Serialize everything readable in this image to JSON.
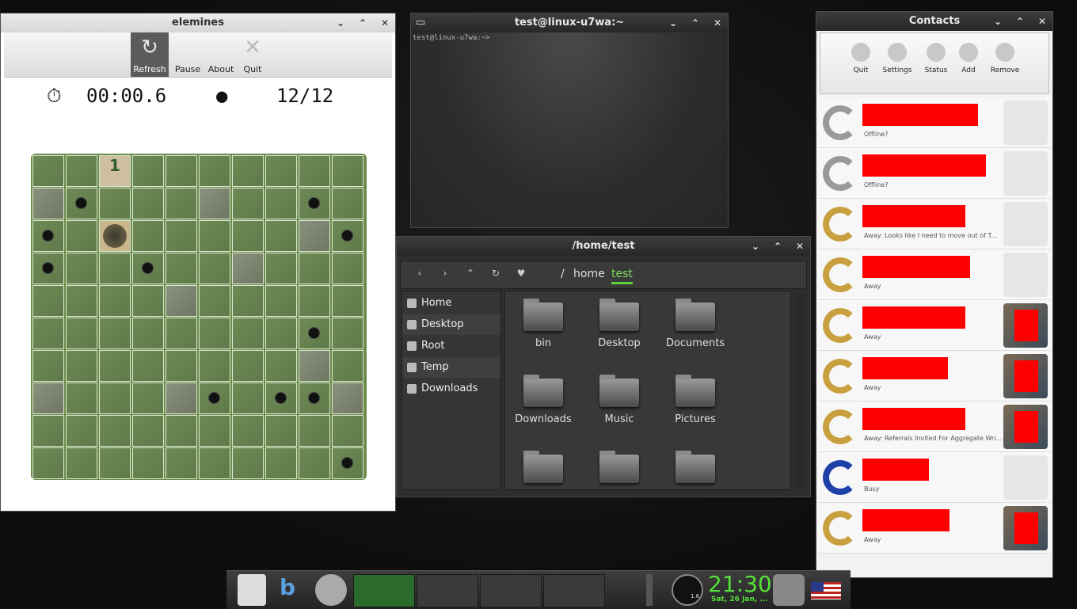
{
  "elemines": {
    "title": "elemines",
    "toolbar": {
      "refresh": "Refresh",
      "pause": "Pause",
      "about": "About",
      "quit": "Quit"
    },
    "timer": "00:00.6",
    "mines_counter": "12/12",
    "revealed_number": "1"
  },
  "terminal": {
    "title": "test@linux-u7wa:~",
    "prompt": "test@linux-u7wa:~> "
  },
  "filemanager": {
    "title": "/home/test",
    "breadcrumb": {
      "root": "/",
      "home": "home",
      "current": "test"
    },
    "sidebar": [
      {
        "label": "Home"
      },
      {
        "label": "Desktop"
      },
      {
        "label": "Root"
      },
      {
        "label": "Temp"
      },
      {
        "label": "Downloads"
      }
    ],
    "folders": [
      {
        "label": "bin"
      },
      {
        "label": "Desktop"
      },
      {
        "label": "Documents"
      },
      {
        "label": "Downloads"
      },
      {
        "label": "Music"
      },
      {
        "label": "Pictures"
      },
      {
        "label": ""
      },
      {
        "label": ""
      },
      {
        "label": ""
      }
    ]
  },
  "contacts": {
    "title": "Contacts",
    "toolbar": {
      "quit": "Quit",
      "settings": "Settings",
      "status": "Status",
      "add": "Add",
      "remove": "Remove"
    },
    "list": [
      {
        "status": "offline",
        "message": "Offline?"
      },
      {
        "status": "offline",
        "message": "Offline?"
      },
      {
        "status": "away",
        "message": "Away: Looks like I need to move out of T..."
      },
      {
        "status": "away",
        "message": "Away"
      },
      {
        "status": "away",
        "message": "Away"
      },
      {
        "status": "away",
        "message": "Away"
      },
      {
        "status": "away",
        "message": "Away: Referrals Invited For Aggregate Wri..."
      },
      {
        "status": "busy",
        "message": "Busy"
      },
      {
        "status": "away",
        "message": "Away"
      }
    ]
  },
  "taskbar": {
    "clock": "21:30",
    "date": "Sat, 26 Jan, ...",
    "gauge_value": "1.6"
  },
  "colors": {
    "accent_green": "#55e03a",
    "redaction": "#ff0000",
    "away": "#c9a040",
    "busy": "#1d3fa8"
  }
}
